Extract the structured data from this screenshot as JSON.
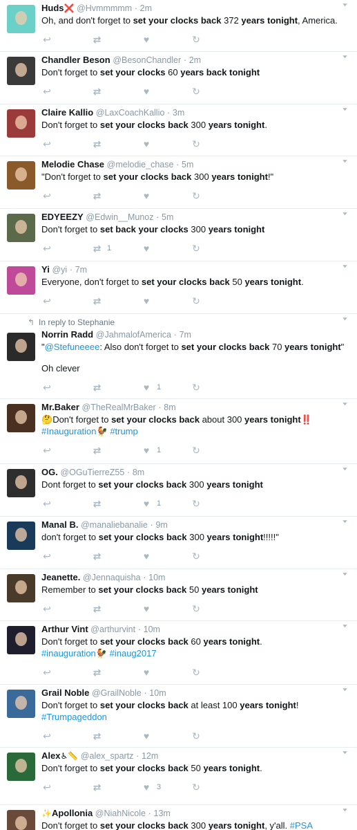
{
  "tweets": [
    {
      "name": "Huds",
      "badge": "❌",
      "handle": "@Hvmmmmm",
      "time": "2m",
      "text_pre": "Oh, and don't forget to ",
      "bold1": "set your clocks back",
      "text_mid": " 372 ",
      "bold2": "years tonight",
      "text_post": ", America.",
      "avatar_color": "#6ad0c8"
    },
    {
      "name": "Chandler Beson",
      "handle": "@BesonChandler",
      "time": "2m",
      "text_pre": "Don't forget to ",
      "bold1": "set your clocks",
      "text_mid": " 60 ",
      "bold2": "years back tonight",
      "text_post": "",
      "avatar_color": "#3a3a3a"
    },
    {
      "name": "Claire Kallio",
      "handle": "@LaxCoachKallio",
      "time": "3m",
      "text_pre": "Don't forget to ",
      "bold1": "set your clocks back",
      "text_mid": " 300 ",
      "bold2": "years tonight",
      "text_post": ".",
      "avatar_color": "#9a3a3a"
    },
    {
      "name": "Melodie Chase",
      "handle": "@melodie_chase",
      "time": "5m",
      "text_pre": "\"Don't forget to ",
      "bold1": "set your clocks back",
      "text_mid": " 300 ",
      "bold2": "years tonight",
      "text_post": "!\"",
      "avatar_color": "#8a5a2a"
    },
    {
      "name": "EDYEEZY",
      "handle": "@Edwin__Munoz",
      "time": "5m",
      "text_pre": "Don't forget to ",
      "bold1": "set back your clocks",
      "text_mid": " 300 ",
      "bold2": "years tonight",
      "text_post": "",
      "avatar_color": "#5a6a4a",
      "retweets": "1"
    },
    {
      "name": "Yi",
      "handle": "@yi",
      "time": "7m",
      "text_pre": "Everyone, don't forget to ",
      "bold1": "set your clocks back",
      "text_mid": " 50 ",
      "bold2": "years tonight",
      "text_post": ".",
      "avatar_color": "#c04a9a"
    },
    {
      "context": "In reply to Stephanie",
      "name": "Norrin Radd",
      "handle": "@JahmalofAmerica",
      "time": "7m",
      "mention": "@Stefuneeee",
      "text_pre": ": Also don't forget to ",
      "bold1": "set your clocks back",
      "text_mid": " 70 ",
      "bold2": "years tonight",
      "text_post": "\"",
      "quote_open": "\"",
      "extra": "Oh clever",
      "avatar_color": "#2a2a2a",
      "likes": "1"
    },
    {
      "name": "Mr.Baker",
      "handle": "@TheRealMrBaker",
      "time": "8m",
      "emoji_pre": "🤔",
      "text_pre": "Don't forget to ",
      "bold1": "set your clocks back",
      "text_mid": " about 300 ",
      "bold2": "years tonight",
      "text_post": "",
      "emoji_post": "‼️",
      "hashtags": [
        "#Inauguration",
        "#trump"
      ],
      "hashtag_emoji": "🐓",
      "avatar_color": "#4a3020",
      "likes": "1"
    },
    {
      "name": "OG.",
      "handle": "@OGuTierreZ55",
      "time": "8m",
      "text_pre": "Dont forget to ",
      "bold1": "set your clocks back",
      "text_mid": " 300 ",
      "bold2": "years tonight",
      "text_post": "",
      "avatar_color": "#2e2e2e",
      "likes": "1"
    },
    {
      "name": "Manal B.",
      "handle": "@manaliebanalie",
      "time": "9m",
      "text_pre": "don't forget to ",
      "bold1": "set your clocks back",
      "text_mid": " 300 ",
      "bold2": "years tonight",
      "text_post": "!!!!!\"",
      "avatar_color": "#1a3a5a"
    },
    {
      "name": "Jeanette.",
      "handle": "@Jennaquisha",
      "time": "10m",
      "text_pre": "Remember to ",
      "bold1": "set your clocks back",
      "text_mid": " 50 ",
      "bold2": "years tonight",
      "text_post": "",
      "avatar_color": "#4a3a2a"
    },
    {
      "name": "Arthur Vint",
      "handle": "@arthurvint",
      "time": "10m",
      "text_pre": "Don't forget to ",
      "bold1": "set your clocks back",
      "text_mid": " 60 ",
      "bold2": "years tonight",
      "text_post": ".",
      "hashtags": [
        "#inauguration",
        "#inaug2017"
      ],
      "hashtag_emoji": "🐓",
      "avatar_color": "#1e1e2e"
    },
    {
      "name": "Grail Noble",
      "handle": "@GrailNoble",
      "time": "10m",
      "text_pre": "Don't forget to ",
      "bold1": "set your clocks back",
      "text_mid": " at least 100 ",
      "bold2": "years tonight",
      "text_post": "!",
      "hashtags": [
        "#Trumpageddon"
      ],
      "avatar_color": "#3a6a9a"
    },
    {
      "name": "Alex",
      "badge": "♿📏",
      "handle": "@alex_spartz",
      "time": "12m",
      "text_pre": "Don't forget to ",
      "bold1": "set your clocks back",
      "text_mid": " 50 ",
      "bold2": "years tonight",
      "text_post": ".",
      "avatar_color": "#2a6a3a",
      "likes": "3"
    },
    {
      "name_emoji": "✨",
      "name": "Apollonia",
      "handle": "@NiahNicole",
      "time": "13m",
      "text_pre": "Don't forget to ",
      "bold1": "set your clocks back",
      "text_mid": " 300 ",
      "bold2": "years tonight",
      "text_post": ", y'all. ",
      "inline_hashtag": "#PSA",
      "avatar_color": "#6a4a3a"
    }
  ],
  "icons": {
    "reply": "reply-icon",
    "retweet": "retweet-icon",
    "like": "heart-icon",
    "dm": "direct-message-icon",
    "caret": "chevron-down-icon"
  }
}
